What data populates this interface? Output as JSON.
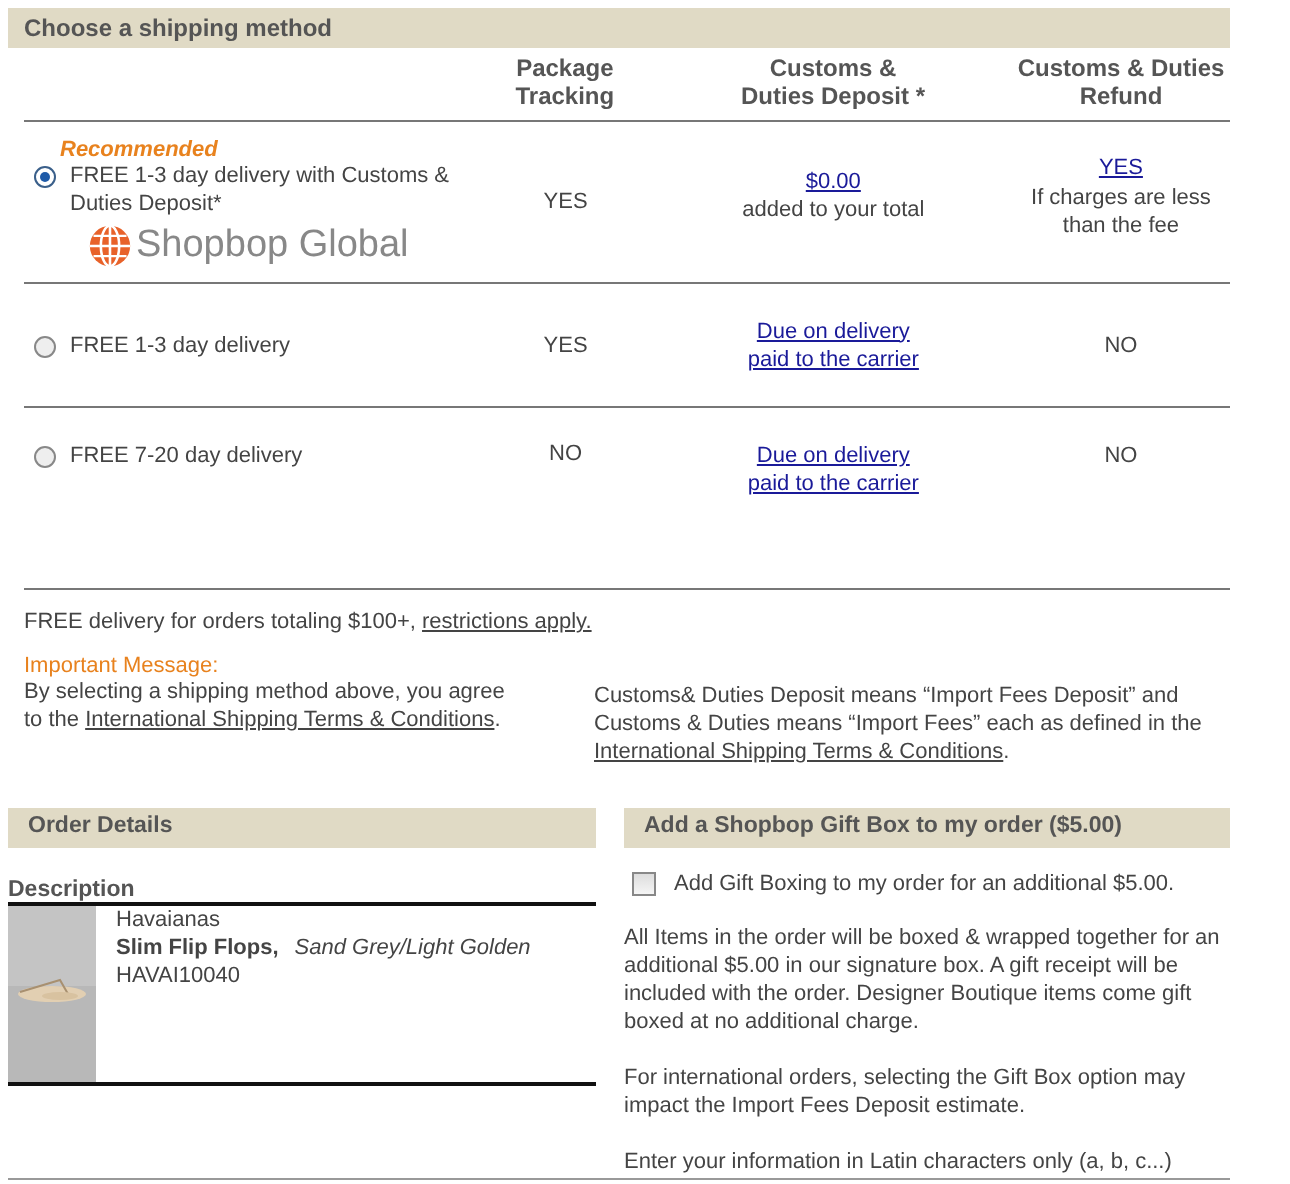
{
  "shipping": {
    "title": "Choose a shipping method",
    "columns": [
      "Package Tracking",
      "Customs & Duties Deposit *",
      "Customs & Duties Refund"
    ],
    "options": [
      {
        "selected": true,
        "tag": "Recommended",
        "label": "FREE 1-3 day delivery with Customs & Duties Deposit*",
        "logo": "Shopbop Global",
        "tracking": "YES",
        "deposit": {
          "kind": "link",
          "lines": [
            "$0.00"
          ],
          "note": "added to your total"
        },
        "refund": {
          "kind": "link",
          "lines": [
            "YES"
          ],
          "note": "If charges are less than the fee"
        }
      },
      {
        "selected": false,
        "label": "FREE 1-3 day delivery",
        "tracking": "YES",
        "deposit": {
          "kind": "link",
          "lines": [
            "Due on delivery",
            "paid to the carrier"
          ]
        },
        "refund": {
          "kind": "text",
          "lines": [
            "NO"
          ]
        }
      },
      {
        "selected": false,
        "label": "FREE 7-20 day delivery",
        "tracking": "NO",
        "deposit": {
          "kind": "link",
          "lines": [
            "Due on delivery",
            "paid to the carrier"
          ]
        },
        "refund": {
          "kind": "text",
          "lines": [
            "NO"
          ]
        }
      }
    ],
    "free_note": {
      "text": "FREE delivery for orders totaling $100+,",
      "link": "restrictions apply."
    },
    "important": {
      "heading": "Important Message:",
      "text": "By selecting a shipping method above, you agree to the",
      "link": "International Shipping Terms & Conditions",
      "end": "."
    },
    "definition": {
      "text": "Customs& Duties Deposit means “Import Fees Deposit” and Customs & Duties means “Import Fees” each as defined in the",
      "link": "International Shipping Terms & Conditions",
      "end": "."
    }
  },
  "order": {
    "title": "Order Details",
    "description_label": "Description",
    "item": {
      "brand": "Havaianas",
      "name": "Slim Flip Flops,",
      "variant": "Sand Grey/Light Golden",
      "sku": "HAVAI10040"
    }
  },
  "gift": {
    "title": "Add a Shopbop Gift Box to my order ($5.00)",
    "checked": false,
    "checkbox_label": "Add Gift Boxing to my order for an additional $5.00.",
    "paragraphs": [
      "All Items in the order will be boxed & wrapped together for an additional $5.00 in our signature box. A gift receipt will be included with the order. Designer Boutique items come gift boxed at no additional charge.",
      "For international orders, selecting the Gift Box option may impact the Import Fees Deposit estimate.",
      "Enter your information in Latin characters only (a, b, c...)"
    ]
  }
}
